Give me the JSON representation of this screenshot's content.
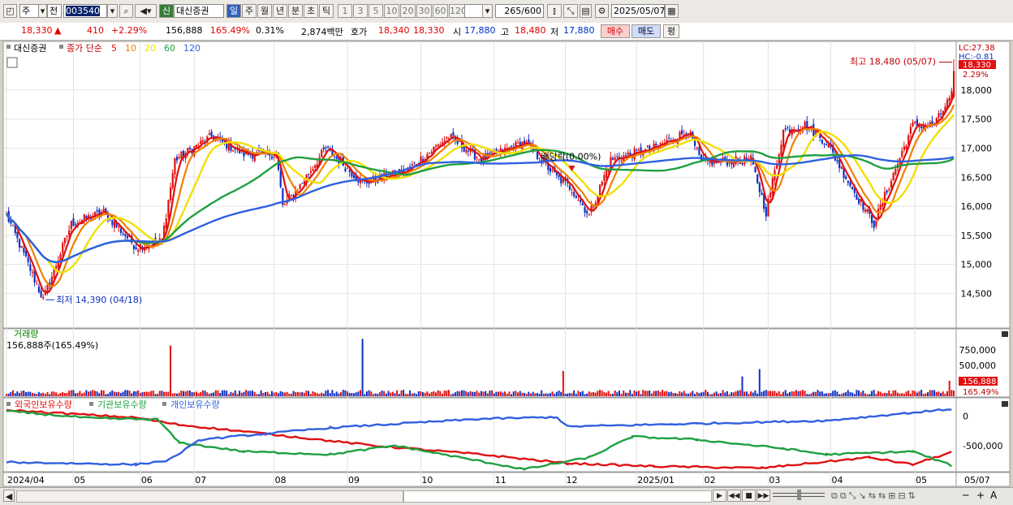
{
  "toolbar": {
    "type_code": "주",
    "prev_label": "전",
    "stock_code": "003540",
    "stock_name": "대신증권",
    "credit_badge": "신",
    "periods": [
      "일",
      "주",
      "월",
      "년",
      "분",
      "초",
      "틱"
    ],
    "active_period": "일",
    "intervals": [
      "1",
      "3",
      "5",
      "10",
      "20",
      "30",
      "60",
      "120"
    ],
    "count": "265",
    "count_total": "/600",
    "date": "2025/05/07"
  },
  "quote": {
    "price": "18,330",
    "arrow": "▲",
    "change": "410",
    "change_pct": "+2.29%",
    "volume": "156,888",
    "volume_ratio": "165.49%",
    "turnover": "0.31%",
    "amount": "2,874백만",
    "bid_label": "호가",
    "bid": "18,340",
    "ask": "18,330",
    "open_label": "시",
    "open": "17,880",
    "high_label": "고",
    "high": "18,480",
    "low_label": "저",
    "low": "17,880",
    "buy_button": "매수",
    "sell_button": "매도",
    "eval_button": "평"
  },
  "chart_data": {
    "type": "candlestick",
    "title": "대신증권",
    "legend_prefix": "종가 단순",
    "ma_periods": [
      "5",
      "10",
      "20",
      "60",
      "120"
    ],
    "ma_colors": [
      "#e01010",
      "#f08000",
      "#f0e000",
      "#20a040",
      "#3060e0"
    ],
    "x_month_labels": [
      "2024/04",
      "05",
      "06",
      "07",
      "08",
      "09",
      "10",
      "11",
      "12",
      "2025/01",
      "02",
      "03",
      "04",
      "05",
      "05/07"
    ],
    "price_axis": {
      "min": 14100,
      "max": 18600,
      "ticks": [
        14500,
        15000,
        15500,
        16000,
        16500,
        17000,
        17500,
        18000
      ]
    },
    "price_tick_labels": [
      "14,500",
      "15,000",
      "15,500",
      "16,000",
      "16,500",
      "17,000",
      "17,500",
      "18,000"
    ],
    "anchors": [
      {
        "i": 0,
        "c": 15850
      },
      {
        "i": 10,
        "c": 15000
      },
      {
        "i": 17,
        "c": 14390
      },
      {
        "i": 30,
        "c": 15700
      },
      {
        "i": 45,
        "c": 15900
      },
      {
        "i": 60,
        "c": 15300
      },
      {
        "i": 72,
        "c": 15400
      },
      {
        "i": 78,
        "c": 16800
      },
      {
        "i": 95,
        "c": 17200
      },
      {
        "i": 110,
        "c": 16900
      },
      {
        "i": 125,
        "c": 16900
      },
      {
        "i": 128,
        "c": 16000
      },
      {
        "i": 135,
        "c": 16300
      },
      {
        "i": 148,
        "c": 17000
      },
      {
        "i": 165,
        "c": 16400
      },
      {
        "i": 185,
        "c": 16600
      },
      {
        "i": 205,
        "c": 17200
      },
      {
        "i": 220,
        "c": 16800
      },
      {
        "i": 240,
        "c": 17100
      },
      {
        "i": 255,
        "c": 16500
      },
      {
        "i": 262,
        "c": 16300
      },
      {
        "i": 270,
        "c": 15850
      },
      {
        "i": 280,
        "c": 16800
      },
      {
        "i": 300,
        "c": 17000
      },
      {
        "i": 316,
        "c": 17300
      },
      {
        "i": 322,
        "c": 16750
      },
      {
        "i": 345,
        "c": 16800
      },
      {
        "i": 352,
        "c": 15900
      },
      {
        "i": 360,
        "c": 17300
      },
      {
        "i": 370,
        "c": 17400
      },
      {
        "i": 380,
        "c": 17100
      },
      {
        "i": 392,
        "c": 16300
      },
      {
        "i": 402,
        "c": 15700
      },
      {
        "i": 420,
        "c": 17400
      },
      {
        "i": 430,
        "c": 17400
      },
      {
        "i": 438,
        "c": 17920
      },
      {
        "i": 439,
        "c": 18330
      }
    ],
    "bar_count": 440,
    "high_annotation": "최고 18,480 (05/07)",
    "low_annotation": "최저 14,390 (04/18)",
    "dividend_annotation": "배당락(0.00%)",
    "right_labels": {
      "lc": "LC:27.38",
      "hc": "HC:-0.81",
      "price": "18,330",
      "pct": "2.29%"
    },
    "volume_pane": {
      "title": "거래량",
      "summary": "156,888주(165.49%)",
      "ticks": [
        "750,000",
        "500,000"
      ],
      "tick_values": [
        750000,
        500000
      ],
      "max": 1000000,
      "last": "156,888",
      "last_pct": "165.49%",
      "spikes": [
        {
          "i": 76,
          "v": 820000
        },
        {
          "i": 165,
          "v": 930000
        },
        {
          "i": 258,
          "v": 410000
        },
        {
          "i": 341,
          "v": 320000
        },
        {
          "i": 349,
          "v": 440000
        },
        {
          "i": 437,
          "v": 250000
        }
      ],
      "base": 80000
    },
    "holdings_pane": {
      "series": [
        "외국인보유수량",
        "기관보유수량",
        "개인보유수량"
      ],
      "colors": [
        "#e01010",
        "#20a040",
        "#3060e0"
      ],
      "ticks": [
        "0",
        "-500,000"
      ],
      "tick_values": [
        0,
        -500000
      ],
      "ylim": [
        -900000,
        250000
      ],
      "foreign": [
        [
          0,
          100000
        ],
        [
          60,
          -30000
        ],
        [
          80,
          -150000
        ],
        [
          120,
          -300000
        ],
        [
          170,
          -500000
        ],
        [
          220,
          -650000
        ],
        [
          260,
          -800000
        ],
        [
          300,
          -850000
        ],
        [
          350,
          -880000
        ],
        [
          400,
          -700000
        ],
        [
          420,
          -820000
        ],
        [
          439,
          -600000
        ]
      ],
      "institution": [
        [
          0,
          80000
        ],
        [
          40,
          -40000
        ],
        [
          70,
          -60000
        ],
        [
          80,
          -450000
        ],
        [
          110,
          -600000
        ],
        [
          150,
          -650000
        ],
        [
          180,
          -500000
        ],
        [
          210,
          -700000
        ],
        [
          240,
          -900000
        ],
        [
          270,
          -700000
        ],
        [
          290,
          -350000
        ],
        [
          320,
          -400000
        ],
        [
          360,
          -550000
        ],
        [
          380,
          -650000
        ],
        [
          420,
          -600000
        ],
        [
          439,
          -850000
        ]
      ],
      "individual": [
        [
          0,
          -780000
        ],
        [
          60,
          -820000
        ],
        [
          75,
          -750000
        ],
        [
          90,
          -400000
        ],
        [
          150,
          -200000
        ],
        [
          220,
          -50000
        ],
        [
          255,
          -20000
        ],
        [
          260,
          -180000
        ],
        [
          320,
          -130000
        ],
        [
          380,
          -80000
        ],
        [
          439,
          120000
        ]
      ]
    }
  },
  "bottom": {
    "nav_symbols": [
      "▶",
      "◀◀",
      "■",
      "▶▶"
    ],
    "zoom_symbols": [
      "─",
      "+",
      "A"
    ]
  }
}
